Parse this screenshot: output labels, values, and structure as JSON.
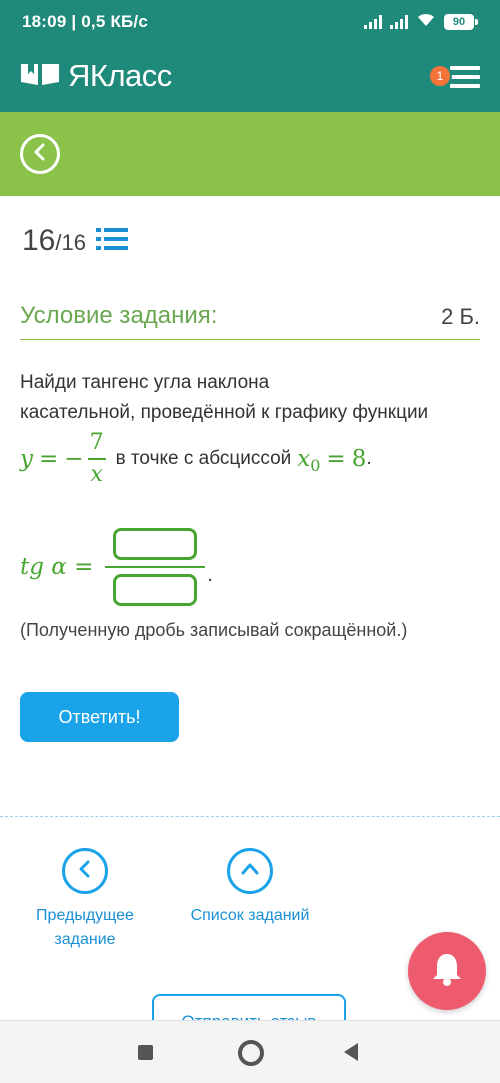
{
  "status_bar": {
    "time_and_speed": "18:09 | 0,5 КБ/с",
    "battery": "90"
  },
  "app_bar": {
    "logo_text": "ЯКласс",
    "notification_count": "1"
  },
  "task": {
    "counter_current": "16",
    "counter_total": "/16",
    "condition_title": "Условие задания:",
    "points": "2 Б.",
    "text_line1": "Найди тангенс угла наклона",
    "text_line2": "касательной, проведённой к графику функции",
    "formula_y": "y",
    "formula_eq": "=",
    "formula_minus": "−",
    "formula_num": "7",
    "formula_den": "x",
    "formula_text": "в точке с абсциссой",
    "formula_x0": "x",
    "formula_x0_sub": "0",
    "formula_eq2": "=",
    "formula_val": "8",
    "formula_period": ".",
    "answer_label": "tg α =",
    "answer_period": ".",
    "hint": "(Полученную дробь записывай сокращённой.)"
  },
  "buttons": {
    "submit": "Ответить!",
    "prev_label": "Предыдущее задание",
    "list_label": "Список заданий",
    "feedback": "Отправить отзыв"
  },
  "colors": {
    "primary_teal": "#1f8a7a",
    "accent_green": "#8bc34a",
    "button_blue": "#1aa3e8",
    "bell_red": "#ef5b6e",
    "badge_orange": "#f4733a"
  }
}
